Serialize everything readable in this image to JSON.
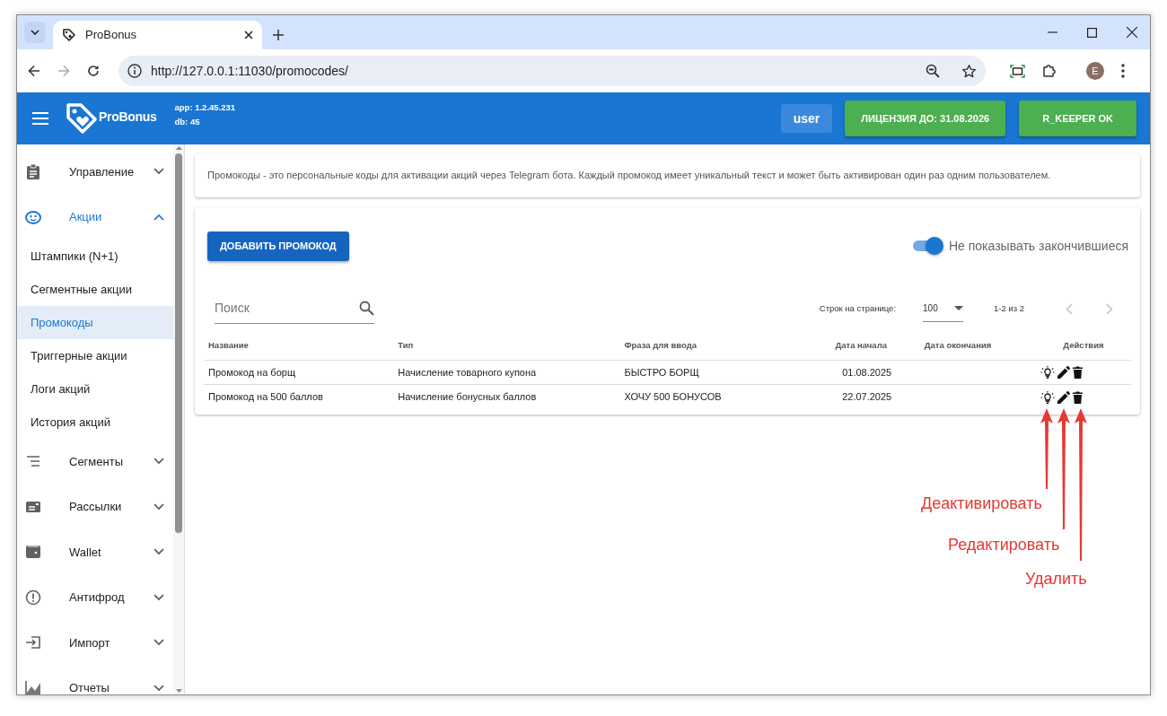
{
  "browser": {
    "tab_title": "ProBonus",
    "url": "http://127.0.0.1:11030/promocodes/",
    "profile_initial": "E"
  },
  "header": {
    "logo_text": "ProBonus",
    "app_version": "app: 1.2.45.231",
    "db_version": "db: 45",
    "user": "user",
    "license": "ЛИЦЕНЗИЯ ДО: 31.08.2026",
    "rkeeper": "R_KEEPER OK"
  },
  "sidebar": {
    "items": [
      {
        "label": "Управление",
        "selected": false,
        "expanded": false
      },
      {
        "label": "Акции",
        "selected": true,
        "expanded": true,
        "children": [
          {
            "label": "Штампики (N+1)",
            "selected": false
          },
          {
            "label": "Сегментные акции",
            "selected": false
          },
          {
            "label": "Промокоды",
            "selected": true
          },
          {
            "label": "Триггерные акции",
            "selected": false
          },
          {
            "label": "Логи акций",
            "selected": false
          },
          {
            "label": "История акций",
            "selected": false
          }
        ]
      },
      {
        "label": "Сегменты",
        "selected": false,
        "expanded": false
      },
      {
        "label": "Рассылки",
        "selected": false,
        "expanded": false
      },
      {
        "label": "Wallet",
        "selected": false,
        "expanded": false
      },
      {
        "label": "Антифрод",
        "selected": false,
        "expanded": false
      },
      {
        "label": "Импорт",
        "selected": false,
        "expanded": false
      },
      {
        "label": "Отчеты",
        "selected": false,
        "expanded": false
      }
    ]
  },
  "info": "Промокоды - это персональные коды для активации акций через Telegram бота. Каждый промокод имеет уникальный текст и может быть активирован один раз одним пользователем.",
  "add_button": "ДОБАВИТЬ ПРОМОКОД",
  "toggle": {
    "label": "Не показывать закончившиеся",
    "on": true
  },
  "search": {
    "placeholder": "Поиск"
  },
  "pagination": {
    "rows_label": "Строк на странице:",
    "rows_value": "100",
    "range": "1-2 из 2",
    "prev_disabled": true,
    "next_disabled": true
  },
  "table": {
    "columns": [
      "Название",
      "Тип",
      "Фраза для ввода",
      "Дата начала",
      "Дата окончания",
      "Действия"
    ],
    "rows": [
      {
        "name": "Промокод на борщ",
        "type": "Начисление товарного купона",
        "phrase": "БЫСТРО БОРЩ",
        "start": "01.08.2025"
      },
      {
        "name": "Промокод на 500 баллов",
        "type": "Начисление бонусных баллов",
        "phrase": "ХОЧУ 500 БОНУСОВ",
        "start": "22.07.2025"
      }
    ]
  },
  "annotations": [
    {
      "label": "Деактивировать"
    },
    {
      "label": "Редактировать"
    },
    {
      "label": "Удалить"
    }
  ]
}
